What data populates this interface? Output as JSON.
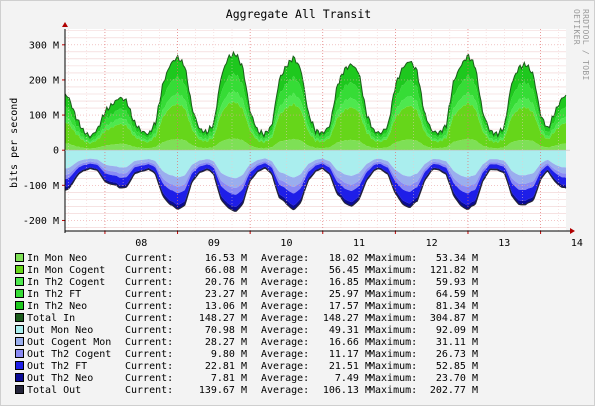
{
  "chart_data": {
    "type": "area",
    "title": "Aggregate All Transit",
    "ylabel": "bits per second",
    "watermark": "RRDTOOL / TOBI OETIKER",
    "ylim": [
      -230,
      345
    ],
    "y_ticks": [
      300,
      200,
      100,
      0,
      -100,
      -200
    ],
    "y_tick_labels": [
      "300 M",
      "200 M",
      "100 M",
      "0",
      "-100 M",
      "-200 M"
    ],
    "x_range_days": [
      7.45,
      14.35
    ],
    "x_ticks": [
      8,
      9,
      10,
      11,
      12,
      13,
      14
    ],
    "x_tick_labels": [
      "08",
      "09",
      "10",
      "11",
      "12",
      "13",
      "14"
    ],
    "grid": true,
    "sample_x": [
      7.45,
      7.5,
      7.6,
      7.7,
      7.8,
      7.9,
      8.0,
      8.1,
      8.2,
      8.3,
      8.4,
      8.5,
      8.6,
      8.7,
      8.8,
      8.9,
      9.0,
      9.1,
      9.2,
      9.3,
      9.4,
      9.5,
      9.6,
      9.7,
      9.8,
      9.9,
      10.0,
      10.1,
      10.2,
      10.3,
      10.4,
      10.5,
      10.6,
      10.7,
      10.8,
      10.9,
      11.0,
      11.1,
      11.2,
      11.3,
      11.4,
      11.5,
      11.6,
      11.7,
      11.8,
      11.9,
      12.0,
      12.1,
      12.2,
      12.3,
      12.4,
      12.5,
      12.6,
      12.7,
      12.8,
      12.9,
      13.0,
      13.1,
      13.2,
      13.3,
      13.4,
      13.5,
      13.6,
      13.7,
      13.8,
      13.9,
      14.0,
      14.1,
      14.2,
      14.3,
      14.35
    ],
    "total_in_sample": [
      160,
      150,
      95,
      55,
      38,
      60,
      110,
      130,
      150,
      140,
      80,
      55,
      45,
      80,
      190,
      245,
      265,
      240,
      120,
      60,
      50,
      75,
      210,
      265,
      275,
      235,
      110,
      55,
      45,
      70,
      200,
      240,
      265,
      230,
      105,
      55,
      48,
      70,
      185,
      230,
      245,
      220,
      105,
      55,
      48,
      70,
      185,
      235,
      255,
      225,
      105,
      55,
      48,
      70,
      195,
      240,
      270,
      240,
      110,
      55,
      45,
      65,
      190,
      235,
      245,
      215,
      100,
      60,
      110,
      150,
      155
    ],
    "series": [
      {
        "name": "In Mon Neo",
        "color": "#7ee056",
        "current": "16.53 M",
        "average": "18.02 M",
        "maximum": "53.34 M",
        "direction": "in",
        "share": 0.12
      },
      {
        "name": "In Mon Cogent",
        "color": "#66d61a",
        "current": "66.08 M",
        "average": "56.45 M",
        "maximum": "121.82 M",
        "direction": "in",
        "share": 0.38
      },
      {
        "name": "In Th2 Cogent",
        "color": "#4ee84e",
        "current": "20.76 M",
        "average": "16.85 M",
        "maximum": "59.93 M",
        "direction": "in",
        "share": 0.11
      },
      {
        "name": "In Th2 FT",
        "color": "#36dc36",
        "current": "23.27 M",
        "average": "25.97 M",
        "maximum": "64.59 M",
        "direction": "in",
        "share": 0.18
      },
      {
        "name": "In Th2 Neo",
        "color": "#1ec81e",
        "current": "13.06 M",
        "average": "17.57 M",
        "maximum": "81.34 M",
        "direction": "in",
        "share": 0.21
      },
      {
        "name": "Total In",
        "color": "#1c5c1c",
        "current": "148.27 M",
        "average": "148.27 M",
        "maximum": "304.87 M",
        "direction": "total"
      },
      {
        "name": "Out Mon Neo",
        "color": "#aaeeee",
        "current": "70.98 M",
        "average": "49.31 M",
        "maximum": "92.09 M",
        "direction": "out",
        "share": 0.46
      },
      {
        "name": "Out Cogent Mon",
        "color": "#9aaeee",
        "current": "28.27 M",
        "average": "16.66 M",
        "maximum": "31.11 M",
        "direction": "out",
        "share": 0.16
      },
      {
        "name": "Out Th2 Cogent",
        "color": "#8a8af4",
        "current": "9.80 M",
        "average": "11.17 M",
        "maximum": "26.73 M",
        "direction": "out",
        "share": 0.11
      },
      {
        "name": "Out Th2 FT",
        "color": "#1e1ee8",
        "current": "22.81 M",
        "average": "21.51 M",
        "maximum": "52.85 M",
        "direction": "out",
        "share": 0.2
      },
      {
        "name": "Out Th2 Neo",
        "color": "#0a0a96",
        "current": "7.81 M",
        "average": "7.49 M",
        "maximum": "23.70 M",
        "direction": "out",
        "share": 0.07
      },
      {
        "name": "Total Out",
        "color": "#24243a",
        "current": "139.67 M",
        "average": "106.13 M",
        "maximum": "202.77 M",
        "direction": "total"
      }
    ],
    "labels": {
      "current": "Current:",
      "average": "Average:",
      "maximum": "Maximum:"
    }
  }
}
